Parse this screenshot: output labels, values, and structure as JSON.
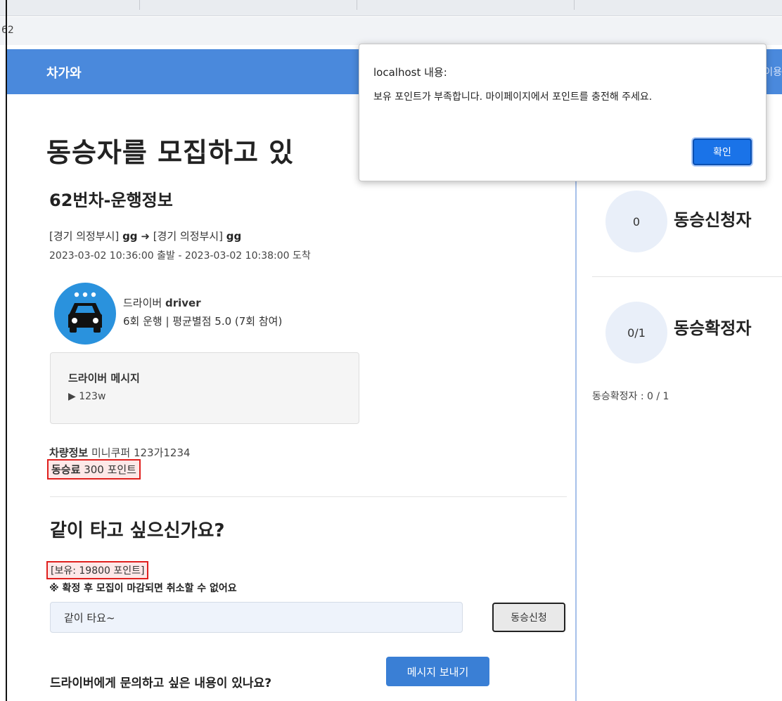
{
  "browser": {
    "address_text": "62"
  },
  "navbar": {
    "brand": "차가와",
    "right_partial": "이용"
  },
  "page": {
    "heading": "동승자를 모집하고 있",
    "section_title": "62번차-운행정보",
    "route": {
      "origin_region": "[경기 의정부시]",
      "origin_place": "gg",
      "arrow": "➜",
      "dest_region": "[경기 의정부시]",
      "dest_place": "gg"
    },
    "schedule": "2023-03-02 10:36:00 출발 - 2023-03-02 10:38:00 도착",
    "driver": {
      "label": "드라이버",
      "name": "driver",
      "stats": "6회 운행 | 평균별점 5.0 (7회 참여)",
      "avatar_icon": "car-icon"
    },
    "driver_message": {
      "title": "드라이버 메시지",
      "body": "▶ 123w"
    },
    "car_info": {
      "label": "차량정보",
      "value": "미니쿠퍼 123가1234"
    },
    "fare": {
      "label": "동승료",
      "value": "300 포인트"
    },
    "join": {
      "title": "같이 타고 싶으신가요?",
      "points": "[보유: 19800 포인트]",
      "warning": "※ 확정 후 모집이 마감되면 취소할 수 없어요",
      "input_value": "같이 타요~",
      "button": "동승신청"
    },
    "ask": {
      "text": "드라이버에게 문의하고 싶은 내용이 있나요?",
      "button": "메시지 보내기"
    }
  },
  "sidebar": {
    "applicants": {
      "count": "0",
      "label": "동승신청자"
    },
    "confirmed": {
      "count": "0/1",
      "label": "동승확정자",
      "summary": "동승확정자 : 0 / 1"
    }
  },
  "dialog": {
    "title": "localhost 내용:",
    "message": "보유 포인트가 부족합니다. 마이페이지에서 포인트를 충전해 주세요.",
    "ok_button": "확인"
  },
  "colors": {
    "navbar": "#4a89dc",
    "avatar": "#2a92dd",
    "highlight_border": "#e0201e",
    "send_button": "#3a7fd5",
    "dialog_ok": "#1a73e8"
  }
}
